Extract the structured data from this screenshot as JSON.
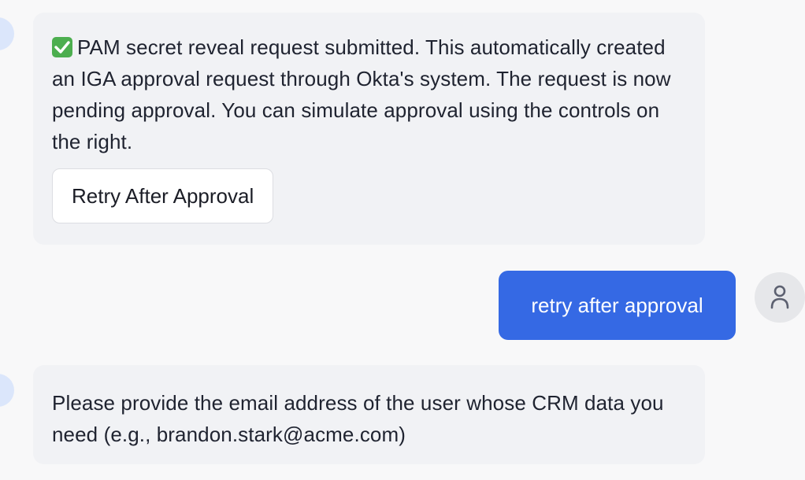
{
  "messages": [
    {
      "role": "assistant",
      "icon": "check-mark-button-icon",
      "text": "PAM secret reveal request submitted. This automatically created an IGA approval request through Okta's system. The request is now pending approval. You can simulate approval using the controls on the right.",
      "action_label": "Retry After Approval"
    },
    {
      "role": "user",
      "text": "retry after approval",
      "icon": "user-icon"
    },
    {
      "role": "assistant",
      "text": "Please provide the email address of the user whose CRM data you need (e.g., brandon.stark@acme.com)"
    }
  ],
  "colors": {
    "page_background": "#f8f8f9",
    "assistant_bubble": "#f1f2f5",
    "user_bubble": "#3569e4",
    "assistant_avatar": "#dbe6fb",
    "user_avatar": "#e6e7ea",
    "check_emoji": "#4cae4f"
  }
}
